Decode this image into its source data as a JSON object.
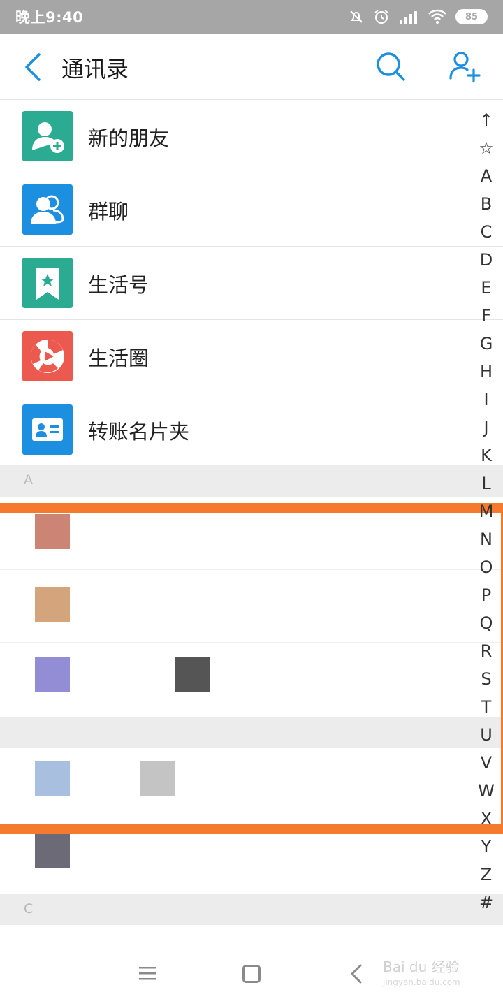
{
  "status_bar": {
    "time": "晚上9:40",
    "battery": "85",
    "icons": [
      "bell-off-icon",
      "alarm-icon",
      "signal-icon",
      "wifi-icon",
      "battery-icon"
    ]
  },
  "header": {
    "title": "通讯录",
    "icons": [
      "back-arrow-icon",
      "search-icon",
      "add-user-icon"
    ]
  },
  "functions": [
    {
      "label": "新的朋友",
      "icon": "new-friend-icon",
      "color": "#2aab92"
    },
    {
      "label": "群聊",
      "icon": "group-chat-icon",
      "color": "#1d8fe1"
    },
    {
      "label": "生活号",
      "icon": "life-account-icon",
      "color": "#2aab92"
    },
    {
      "label": "生活圈",
      "icon": "life-circle-icon",
      "color": "#ec5a4f"
    },
    {
      "label": "转账名片夹",
      "icon": "business-card-icon",
      "color": "#1d8fe1"
    }
  ],
  "sections": [
    {
      "letter": "A"
    },
    {
      "letter": ""
    },
    {
      "letter": "C"
    }
  ],
  "contacts": [
    {
      "avatar_color": "#cc8474"
    },
    {
      "avatar_color": "#d4a47c"
    },
    {
      "avatar_color": "#938dd6",
      "name_color": "#555555"
    },
    {
      "avatar_color": "#a8bfe0",
      "name_color": "#c4c4c4"
    },
    {
      "avatar_color": "#6d6a78"
    }
  ],
  "index_letters": [
    "↑",
    "☆",
    "A",
    "B",
    "C",
    "D",
    "E",
    "F",
    "G",
    "H",
    "I",
    "J",
    "K",
    "L",
    "M",
    "N",
    "O",
    "P",
    "Q",
    "R",
    "S",
    "T",
    "U",
    "V",
    "W",
    "X",
    "Y",
    "Z",
    "#"
  ],
  "highlight_color": "#f57a2d",
  "nav_bar": {
    "icons": [
      "menu-icon",
      "home-icon",
      "back-icon"
    ],
    "watermark": "Bai du 经验",
    "watermark_sub": "jingyan.baidu.com"
  }
}
